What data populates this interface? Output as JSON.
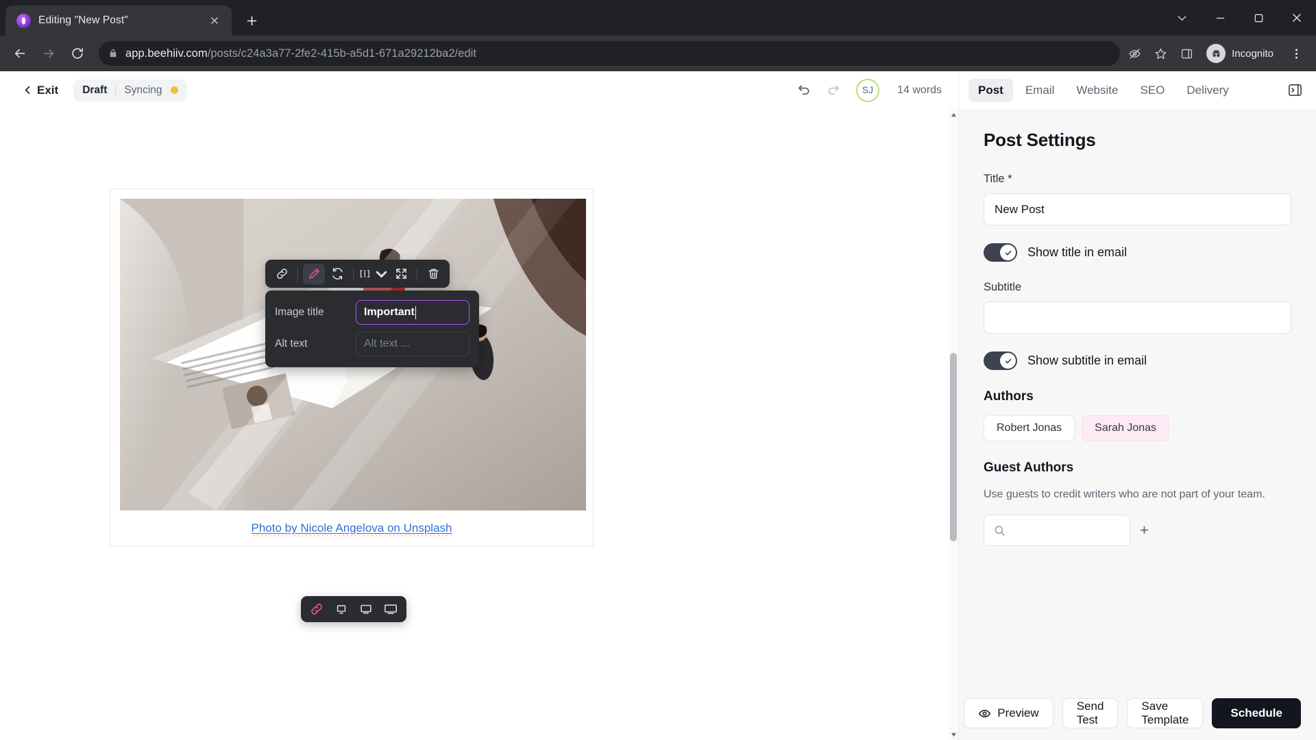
{
  "browser": {
    "tab": {
      "title": "Editing \"New Post\"",
      "favicon": "beehiiv-icon",
      "close": "×"
    },
    "new_tab_label": "+",
    "url": {
      "domain": "app.beehiiv.com",
      "path": "/posts/c24a3a77-2fe2-415b-a5d1-671a29212ba2/edit"
    },
    "profile": {
      "label": "Incognito"
    },
    "window_controls": {
      "minimize": "minimize",
      "maximize": "maximize",
      "close": "close"
    }
  },
  "editor": {
    "exit_label": "Exit",
    "status": {
      "state": "Draft",
      "sync": "Syncing"
    },
    "word_count": "14 words",
    "avatar_initials": "SJ",
    "image_toolbar": [
      "link-icon",
      "edit-pencil-icon",
      "replace-image-icon",
      "align-icon",
      "fullscreen-icon",
      "delete-icon"
    ],
    "alt_popover": {
      "title_label": "Image title",
      "title_value": "Important",
      "alt_label": "Alt text",
      "alt_placeholder": "Alt text ..."
    },
    "caption": {
      "prefix": "Photo by ",
      "author": "Nicole Angelova",
      "middle": " on ",
      "source": "Unsplash"
    }
  },
  "panel": {
    "tabs": [
      {
        "label": "Post",
        "active": true
      },
      {
        "label": "Email",
        "active": false
      },
      {
        "label": "Website",
        "active": false
      },
      {
        "label": "SEO",
        "active": false
      },
      {
        "label": "Delivery",
        "active": false
      }
    ],
    "heading": "Post Settings",
    "title_label": "Title *",
    "title_value": "New Post",
    "show_title_toggle": {
      "label": "Show title in email",
      "on": true
    },
    "subtitle_label": "Subtitle",
    "subtitle_value": "",
    "show_subtitle_toggle": {
      "label": "Show subtitle in email",
      "on": true
    },
    "authors_heading": "Authors",
    "authors": [
      {
        "name": "Robert Jonas",
        "highlighted": false
      },
      {
        "name": "Sarah Jonas",
        "highlighted": true
      }
    ],
    "guest_authors_heading": "Guest Authors",
    "guest_authors_help": "Use guests to credit writers who are not part of your team.",
    "guest_search_placeholder": "",
    "footer": {
      "preview": "Preview",
      "send_test": "Send Test",
      "save_template": "Save Template",
      "schedule": "Schedule"
    }
  },
  "colors": {
    "accent_pink": "#ea4c9a",
    "focus_purple": "#a855f7",
    "status_dot": "#f0c040",
    "avatar_ring": "#b7e07a",
    "primary_btn": "#13161f"
  }
}
